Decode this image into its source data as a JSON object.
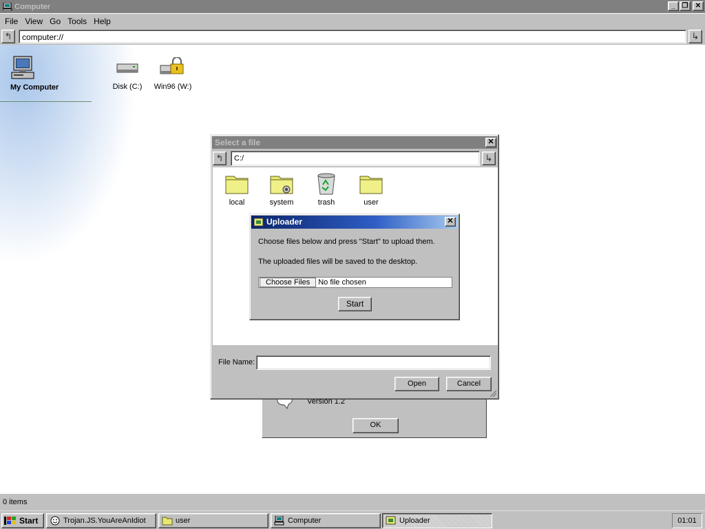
{
  "window": {
    "title": "Computer",
    "controls": {
      "minimize": "_",
      "restore": "❐",
      "close": "✕"
    }
  },
  "menu": [
    "File",
    "View",
    "Go",
    "Tools",
    "Help"
  ],
  "address_bar": {
    "back_icon": "↰",
    "value": "computer://",
    "go_icon": "↳"
  },
  "sidebar": {
    "title": "My Computer"
  },
  "drives": [
    {
      "label": "Disk (C:)",
      "icon": "hard-disk-icon"
    },
    {
      "label": "Win96 (W:)",
      "icon": "locked-drive-icon"
    }
  ],
  "about_dialog": {
    "version": "Version 1.2",
    "ok_label": "OK"
  },
  "file_dialog": {
    "title": "Select a file",
    "close": "✕",
    "path": "C:/",
    "folders": [
      {
        "label": "local",
        "icon": "folder-icon"
      },
      {
        "label": "system",
        "icon": "system-folder-icon"
      },
      {
        "label": "trash",
        "icon": "recycle-bin-icon"
      },
      {
        "label": "user",
        "icon": "folder-icon"
      }
    ],
    "file_name_label": "File Name:",
    "file_name_value": "",
    "open_label": "Open",
    "cancel_label": "Cancel"
  },
  "uploader": {
    "title": "Uploader",
    "close": "✕",
    "message1": "Choose files below and press \"Start\" to upload them.",
    "message2": "The uploaded files will be saved to the desktop.",
    "choose_label": "Choose Files",
    "no_file_text": "No file chosen",
    "start_label": "Start"
  },
  "status": {
    "text": "0 items"
  },
  "taskbar": {
    "start_label": "Start",
    "items": [
      {
        "label": "Trojan.JS.YouAreAnIdiot",
        "icon": "smiley-icon"
      },
      {
        "label": "user",
        "icon": "folder-icon"
      },
      {
        "label": "Computer",
        "icon": "computer-icon"
      },
      {
        "label": "Uploader",
        "icon": "uploader-icon",
        "active": true
      }
    ],
    "clock": "01:01"
  },
  "colors": {
    "face": "#c0c0c0",
    "active_title": "#0a246a",
    "inactive_title": "#808080",
    "folder": "#e8e870"
  }
}
